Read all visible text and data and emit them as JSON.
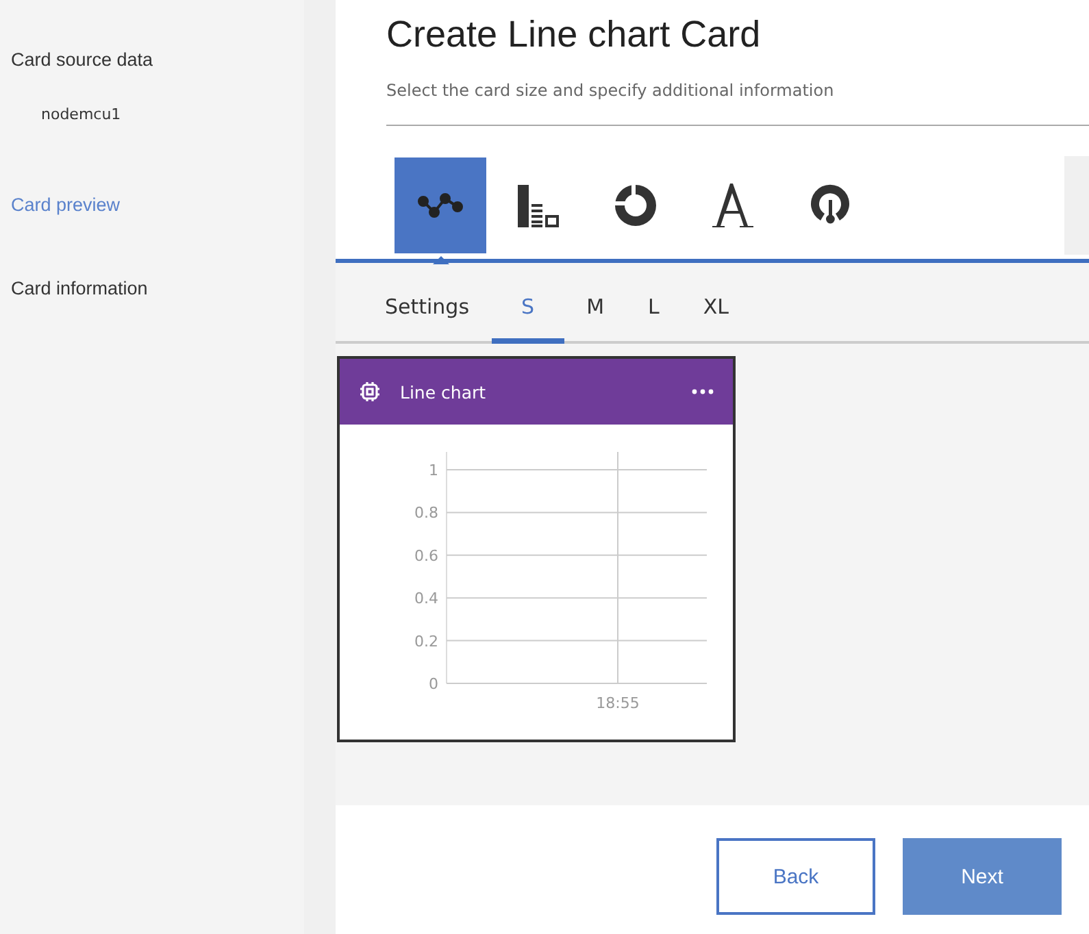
{
  "sidebar": {
    "items": [
      {
        "label": "Card source data",
        "selected": false,
        "children": [
          {
            "label": "nodemcu1"
          }
        ]
      },
      {
        "label": "Card preview",
        "selected": true
      },
      {
        "label": "Card information",
        "selected": false
      }
    ]
  },
  "header": {
    "title": "Create Line chart Card",
    "subtitle": "Select the card size and specify additional information"
  },
  "card_types": [
    {
      "kind": "line",
      "selected": true
    },
    {
      "kind": "bar",
      "selected": false
    },
    {
      "kind": "donut",
      "selected": false
    },
    {
      "kind": "text",
      "selected": false
    },
    {
      "kind": "gauge",
      "selected": false
    }
  ],
  "tabs": [
    {
      "label": "Settings",
      "selected": false
    },
    {
      "label": "S",
      "selected": true
    },
    {
      "label": "M",
      "selected": false
    },
    {
      "label": "L",
      "selected": false
    },
    {
      "label": "XL",
      "selected": false
    }
  ],
  "card": {
    "title": "Line chart",
    "chart_data": {
      "type": "line",
      "categories": [
        "18:55"
      ],
      "ylim": [
        0,
        1
      ],
      "grid": true,
      "yticks": [
        0,
        0.2,
        0.4,
        0.6,
        0.8,
        1
      ]
    }
  },
  "buttons": [
    {
      "kind": "secondary",
      "label": "Back"
    },
    {
      "kind": "primary",
      "label": "Next"
    }
  ]
}
